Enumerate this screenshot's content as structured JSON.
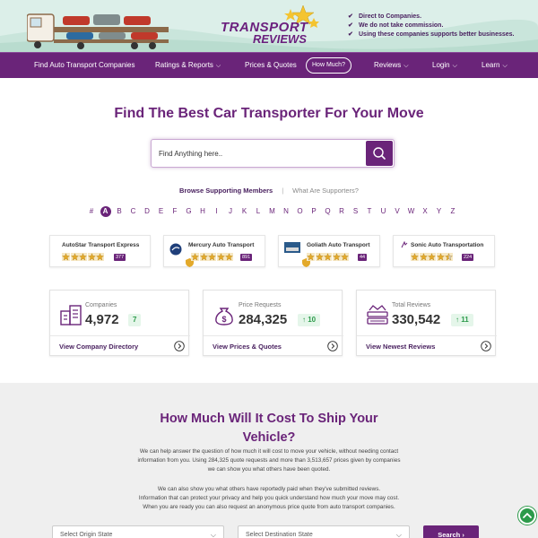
{
  "header": {
    "logo_line1": "TRANSPORT",
    "logo_line2": "REVIEWS",
    "taglines": [
      "Direct to Companies.",
      "We do not take commission.",
      "Using these companies supports better businesses."
    ]
  },
  "nav": {
    "items": [
      {
        "label": "Find Auto Transport Companies",
        "dropdown": false
      },
      {
        "label": "Ratings & Reports",
        "dropdown": true
      },
      {
        "label": "Prices & Quotes",
        "dropdown": false
      },
      {
        "label": "How Much?",
        "dropdown": false,
        "pill": true
      },
      {
        "label": "Reviews",
        "dropdown": true
      },
      {
        "label": "Login",
        "dropdown": true
      },
      {
        "label": "Learn",
        "dropdown": true
      }
    ]
  },
  "hero": {
    "title": "Find The Best Car Transporter For Your Move",
    "search_placeholder": "Find Anything here.."
  },
  "browse": {
    "active": "Browse Supporting Members",
    "other": "What Are Supporters?"
  },
  "alphabet": [
    "#",
    "A",
    "B",
    "C",
    "D",
    "E",
    "F",
    "G",
    "H",
    "I",
    "J",
    "K",
    "L",
    "M",
    "N",
    "O",
    "P",
    "Q",
    "R",
    "S",
    "T",
    "U",
    "V",
    "W",
    "X",
    "Y",
    "Z"
  ],
  "alphabet_active": "A",
  "members": [
    {
      "name": "AutoStar Transport Express",
      "rating_stars": 5,
      "count": "377"
    },
    {
      "name": "Mercury Auto Transport",
      "rating_stars": 5,
      "count": "891"
    },
    {
      "name": "Goliath Auto Transport",
      "rating_stars": 5,
      "count": "44"
    },
    {
      "name": "Sonic Auto Transportation",
      "rating_stars": 4.5,
      "count": "224"
    }
  ],
  "stats": [
    {
      "label": "Companies",
      "value": "4,972",
      "delta": "7",
      "delta_arrow": false,
      "link": "View Company Directory",
      "icon": "building-icon"
    },
    {
      "label": "Price Requests",
      "value": "284,325",
      "delta": "10",
      "delta_arrow": true,
      "link": "View Prices & Quotes",
      "icon": "money-bag-icon"
    },
    {
      "label": "Total Reviews",
      "value": "330,542",
      "delta": "11",
      "delta_arrow": true,
      "link": "View Newest Reviews",
      "icon": "review-crown-icon"
    }
  ],
  "cost": {
    "title_line1": "How Much Will It Cost To Ship Your",
    "title_line2": "Vehicle?",
    "para1": [
      "We can help answer the question of how much it will cost to move your vehicle, without needing contact",
      "information from you. Using 284,325 quote requests and more than 3,513,657 prices given by companies",
      "we can show you what others have been quoted."
    ],
    "para2": [
      "We can also show you what others have reportedly paid when they've submitted reviews.",
      "Information that can protect your privacy and help you quick understand how much your move may cost.",
      "When you are ready you can also request an anonymous price quote from auto transport companies."
    ],
    "origin_placeholder": "Select Origin State",
    "destination_placeholder": "Select Destination State",
    "search_label": "Search"
  },
  "colors": {
    "brand": "#6a2479",
    "positive": "#2c9a4a",
    "banner": "#dcefe9"
  }
}
